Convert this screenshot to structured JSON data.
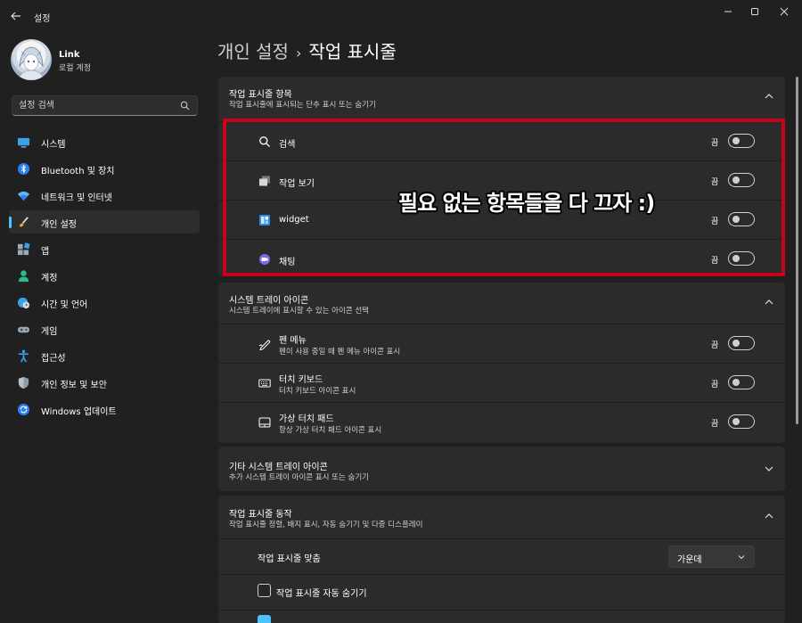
{
  "window": {
    "title": "설정"
  },
  "profile": {
    "name": "Link",
    "account": "로컬 계정"
  },
  "search": {
    "placeholder": "설정 검색"
  },
  "nav": {
    "items": [
      {
        "label": "시스템",
        "icon": "monitor-icon"
      },
      {
        "label": "Bluetooth 및 장치",
        "icon": "bluetooth-icon"
      },
      {
        "label": "네트워크 및 인터넷",
        "icon": "wifi-icon"
      },
      {
        "label": "개인 설정",
        "icon": "brush-icon",
        "active": true
      },
      {
        "label": "앱",
        "icon": "apps-icon"
      },
      {
        "label": "계정",
        "icon": "person-icon"
      },
      {
        "label": "시간 및 언어",
        "icon": "globe-clock-icon"
      },
      {
        "label": "게임",
        "icon": "gamepad-icon"
      },
      {
        "label": "접근성",
        "icon": "accessibility-icon"
      },
      {
        "label": "개인 정보 및 보안",
        "icon": "shield-icon"
      },
      {
        "label": "Windows 업데이트",
        "icon": "update-icon"
      }
    ]
  },
  "breadcrumb": {
    "parent": "개인 설정",
    "separator": "›",
    "current": "작업 표시줄"
  },
  "taskbar_items": {
    "title": "작업 표시줄 항목",
    "subtitle": "작업 표시줄에 표시되는 단추 표시 또는 숨기기",
    "rows": [
      {
        "label": "검색",
        "state": "끔",
        "icon": "search-icon"
      },
      {
        "label": "작업 보기",
        "state": "끔",
        "icon": "task-view-icon"
      },
      {
        "label": "widget",
        "state": "끔",
        "icon": "widgets-icon"
      },
      {
        "label": "채팅",
        "state": "끔",
        "icon": "chat-icon"
      }
    ]
  },
  "tray_icons": {
    "title": "시스템 트레이 아이콘",
    "subtitle": "시스템 트레이에 표시할 수 있는 아이콘 선택",
    "rows": [
      {
        "label": "펜 메뉴",
        "sub": "펜이 사용 중일 때 펜 메뉴 아이콘 표시",
        "state": "끔",
        "icon": "pen-icon"
      },
      {
        "label": "터치 키보드",
        "sub": "터치 키보드 아이콘 표시",
        "state": "끔",
        "icon": "keyboard-icon"
      },
      {
        "label": "가상 터치 패드",
        "sub": "항상 가상 터치 패드 아이콘 표시",
        "state": "끔",
        "icon": "touchpad-icon"
      }
    ]
  },
  "other_tray": {
    "title": "기타 시스템 트레이 아이콘",
    "subtitle": "추가 시스템 트레이 아이콘 표시 또는 숨기기"
  },
  "behaviors": {
    "title": "작업 표시줄 동작",
    "subtitle": "작업 표시줄 정렬, 배지 표시, 자동 숨기기 및 다중 디스플레이",
    "alignment_label": "작업 표시줄 맞춤",
    "alignment_value": "가운데",
    "autohide_label": "작업 표시줄 자동 숨기기"
  },
  "annotation": {
    "text": "필요 없는 항목들을 다 끄자 :)"
  },
  "colors": {
    "accent": "#4cc2ff",
    "highlight_box": "#c8001a",
    "background": "#202020",
    "card": "#2b2b2b"
  }
}
